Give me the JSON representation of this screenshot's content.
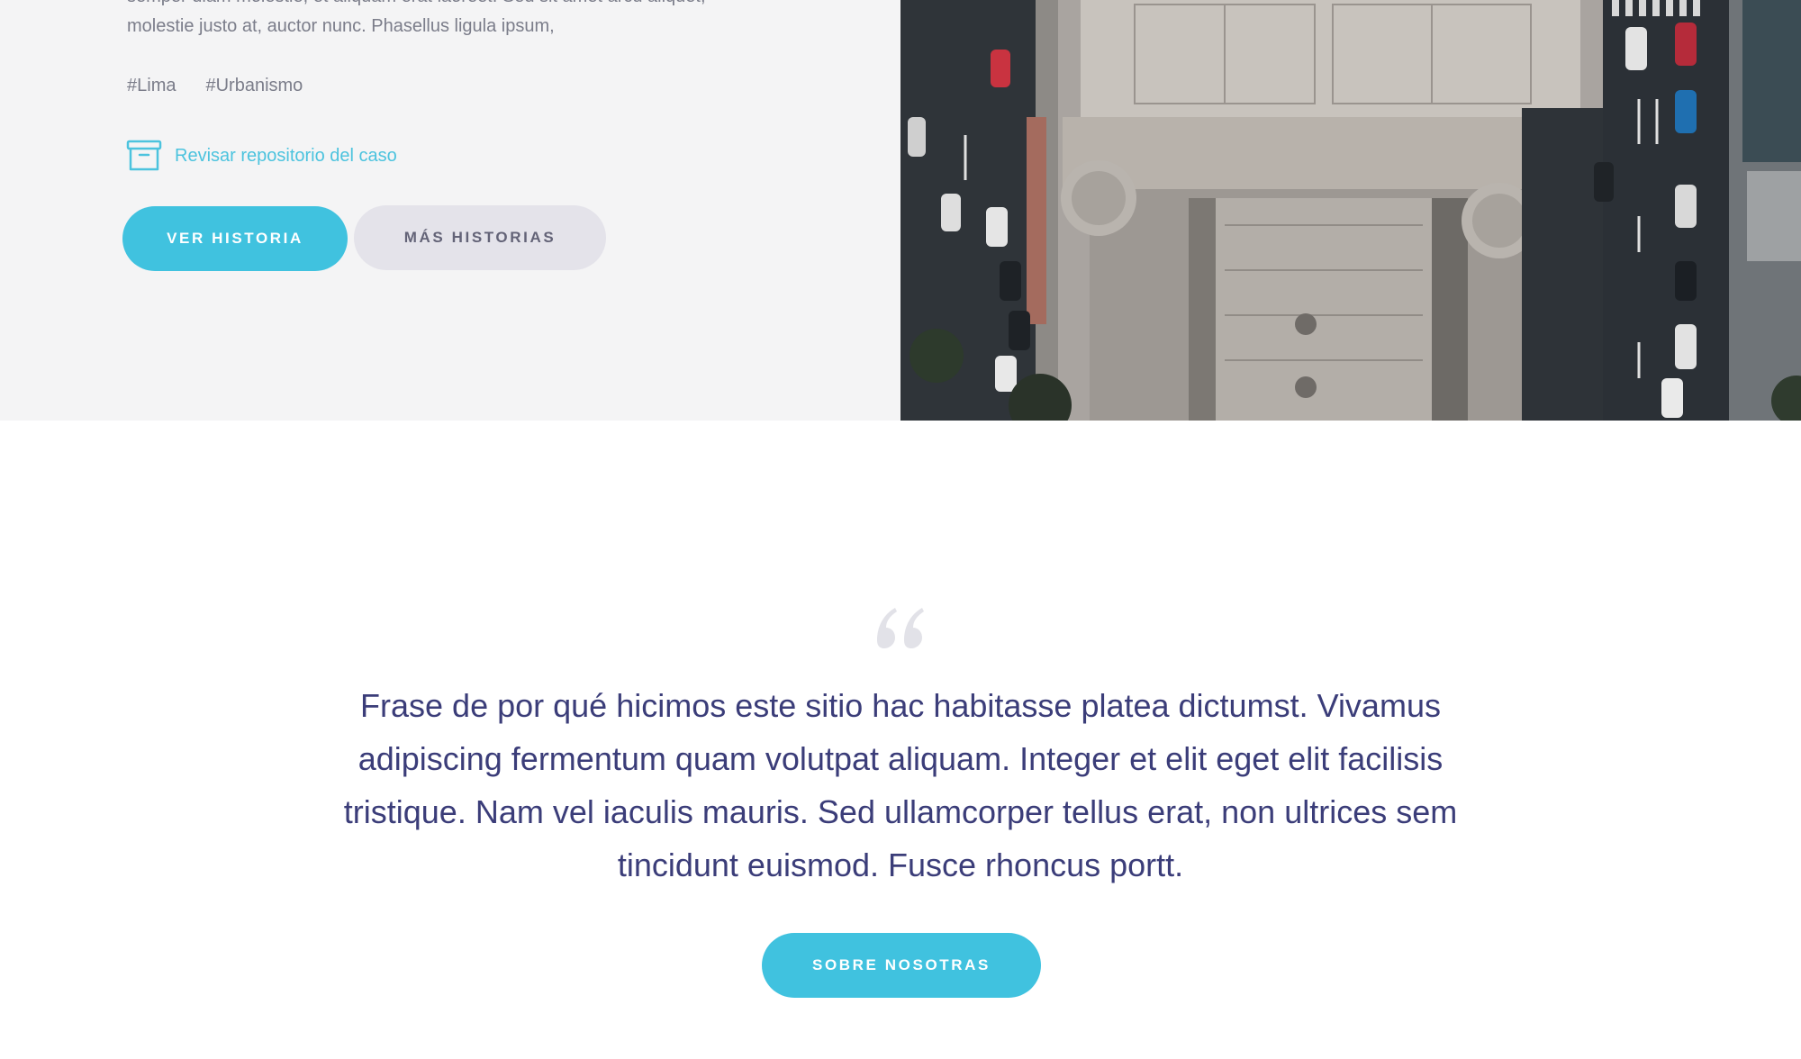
{
  "story": {
    "excerpt": "semper diam molestie, et aliquam erat laoreet. Sed sit amet arcu aliquet, molestie justo at, auctor nunc. Phasellus ligula ipsum,",
    "tags": [
      "#Lima",
      "#Urbanismo"
    ],
    "repo_link_label": "Revisar repositorio del caso",
    "primary_button_label": "VER HISTORIA",
    "secondary_button_label": "MÁS HISTORIAS",
    "photo_description": ""
  },
  "quote": {
    "text": "Frase de por qué hicimos este sitio hac habitasse platea dictumst. Vivamus adipiscing fermentum quam volutpat aliquam. Integer et elit eget elit facilisis tristique. Nam vel iaculis mauris. Sed ullamcorper tellus erat, non ultrices sem tincidunt euismod. Fusce rhoncus portt.",
    "button_label": "SOBRE NOSOTRAS"
  },
  "icons": {
    "repo": "archive-box-icon",
    "quote": "quote-mark-icon"
  },
  "colors": {
    "accent": "#40c2df",
    "link": "#4cc3de",
    "secondary_button_bg": "#e4e3ea",
    "secondary_button_text": "#636377",
    "quote_text": "#3b3d79",
    "body_text": "#7b7d8a",
    "panel_bg": "#f4f4f5"
  }
}
